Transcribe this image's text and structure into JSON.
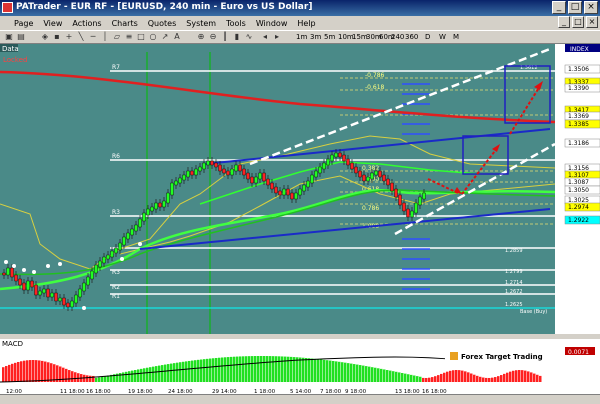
{
  "window": {
    "title": "PATrader - EUR RF - [EURUSD, 240 min - Euro vs US Dollar]"
  },
  "menu": [
    "Page",
    "View",
    "Actions",
    "Charts",
    "Quotes",
    "System",
    "Tools",
    "Window",
    "Help"
  ],
  "timeframes": [
    "1m",
    "3m",
    "5m",
    "10m",
    "15m",
    "30m",
    "60m",
    "240",
    "360",
    "D",
    "W",
    "M"
  ],
  "chart": {
    "panel_label": "Data",
    "status": "Locked",
    "index_label": "INDEX",
    "background": "#4a8a88",
    "levels": [
      {
        "label": "R7",
        "price": "1.3612"
      },
      {
        "label": "R6",
        "price": "1.3185"
      },
      {
        "label": "R5",
        "price": "1.3085"
      },
      {
        "label": "R3",
        "price": "1.2950"
      },
      {
        "label": "R4",
        "price": "1.2859"
      },
      {
        "label": "R3",
        "price": "1.2799"
      },
      {
        "label": "R2",
        "price": "1.2714"
      },
      {
        "label": "R1",
        "price": "1.2672"
      },
      {
        "label": "Base (Buy)",
        "price": "1.2625"
      }
    ],
    "fib_labels": [
      "-0.786",
      "-0.618",
      "0.382",
      "0.500",
      "0.618",
      "0.786",
      "1.000"
    ],
    "price_boxes": [
      {
        "value": "1.3506",
        "color": "#ffffff"
      },
      {
        "value": "1.3337",
        "color": "#ffff00"
      },
      {
        "value": "1.3390",
        "color": "#ffffff"
      },
      {
        "value": "1.3417",
        "color": "#ffff00"
      },
      {
        "value": "1.3369",
        "color": "#ffffff"
      },
      {
        "value": "1.3385",
        "color": "#ffff00"
      },
      {
        "value": "1.3186",
        "color": "#ffffff"
      },
      {
        "value": "1.3156",
        "color": "#ffffff"
      },
      {
        "value": "1.3107",
        "color": "#ffff00"
      },
      {
        "value": "1.3087",
        "color": "#ffffff"
      },
      {
        "value": "1.3050",
        "color": "#ffffff"
      },
      {
        "value": "1.3025",
        "color": "#ffffff"
      },
      {
        "value": "1.2974",
        "color": "#ffff00"
      },
      {
        "value": "1.2922",
        "color": "#00ffff"
      }
    ],
    "dates": [
      "12:00",
      "11 18:00",
      "16 18:00",
      "19 18:00",
      "24 18:00",
      "29 14:00",
      "1 18:00",
      "5 14:00",
      "7 18:00",
      "9 18:00",
      "13 18:00",
      "16 18:00"
    ]
  },
  "macd": {
    "label": "MACD",
    "value": "0.0071",
    "brand": "Forex Target Trading"
  }
}
